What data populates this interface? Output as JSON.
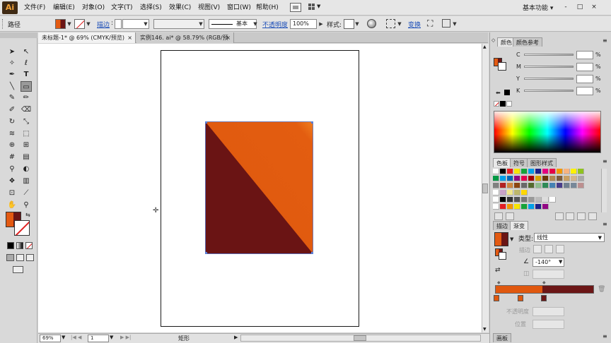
{
  "menubar": {
    "logo": "Ai",
    "items": [
      "文件(F)",
      "编辑(E)",
      "对象(O)",
      "文字(T)",
      "选择(S)",
      "效果(C)",
      "视图(V)",
      "窗口(W)",
      "帮助(H)"
    ],
    "workspace": "基本功能",
    "window_controls": [
      "-",
      "□",
      "×"
    ]
  },
  "controlbar": {
    "path_label": "路径",
    "stroke_label": "描边",
    "stroke_style": "基本",
    "opacity_label": "不透明度",
    "opacity_value": "100%",
    "style_label": "样式:",
    "transform_label": "变换"
  },
  "tabs": [
    {
      "label": "未标题-1* @ 69% (CMYK/预览)",
      "close": "×"
    },
    {
      "label": "实例146. ai* @ 58.79% (RGB/预览)",
      "close": "×"
    }
  ],
  "statusbar": {
    "zoom": "69%",
    "page": "1",
    "tool_status": "矩形"
  },
  "color_panel": {
    "tabs": [
      "颜色",
      "颜色参考"
    ],
    "channels": [
      {
        "name": "C",
        "value": "",
        "unit": "%"
      },
      {
        "name": "M",
        "value": "",
        "unit": "%"
      },
      {
        "name": "Y",
        "value": "",
        "unit": "%"
      },
      {
        "name": "K",
        "value": "",
        "unit": "%"
      }
    ]
  },
  "swatches_panel": {
    "tabs": [
      "色板",
      "符号",
      "图形样式"
    ],
    "row1": [
      "#ffffff",
      "#000000",
      "#e31e24",
      "#f7e400",
      "#16a33a",
      "#00a0e9",
      "#1d2088",
      "#e4007f",
      "#e40046",
      "#f39800",
      "#f6b37f",
      "#fff100",
      "#8fc31f"
    ],
    "row2": [
      "#009944",
      "#00a0e9",
      "#0068b7",
      "#920783",
      "#e5004f",
      "#a40000",
      "#d7a500",
      "#6a3906",
      "#b28850",
      "#7c5c3b",
      "#c9a063",
      "#d2b48c",
      "#a9a9a9"
    ],
    "row3": [
      "#808080",
      "#b22222",
      "#cd853f",
      "#8b4513",
      "#696969",
      "#556b2f",
      "#8fbc8f",
      "#2e8b57",
      "#4682b4",
      "#483d8b",
      "#708090",
      "#778899",
      "#bc8f8f"
    ],
    "row4": [
      "#c8a2c8",
      "#f0e68c",
      "#bdb76b",
      "#ffd700"
    ],
    "row5": [
      "#000000",
      "#333333",
      "#555555",
      "#777777",
      "#999999",
      "#bbbbbb",
      "#dddddd",
      "#ffffff"
    ],
    "row6": [
      "#e31e24",
      "#f39800",
      "#f7e400",
      "#16a33a",
      "#00a0e9",
      "#1d2088",
      "#920783"
    ]
  },
  "gradient_panel": {
    "tabs": [
      "描边",
      "渐变"
    ],
    "type_label": "类型:",
    "type_value": "线性",
    "angle": "-140°",
    "opacity_label": "不透明度",
    "position_label": "位置",
    "stops": [
      "#e0580f",
      "#6c1616"
    ]
  },
  "bottom_panel": {
    "label": "画板"
  },
  "artwork": {
    "light_color": "#e35d10",
    "dark_color": "#6a1414"
  }
}
